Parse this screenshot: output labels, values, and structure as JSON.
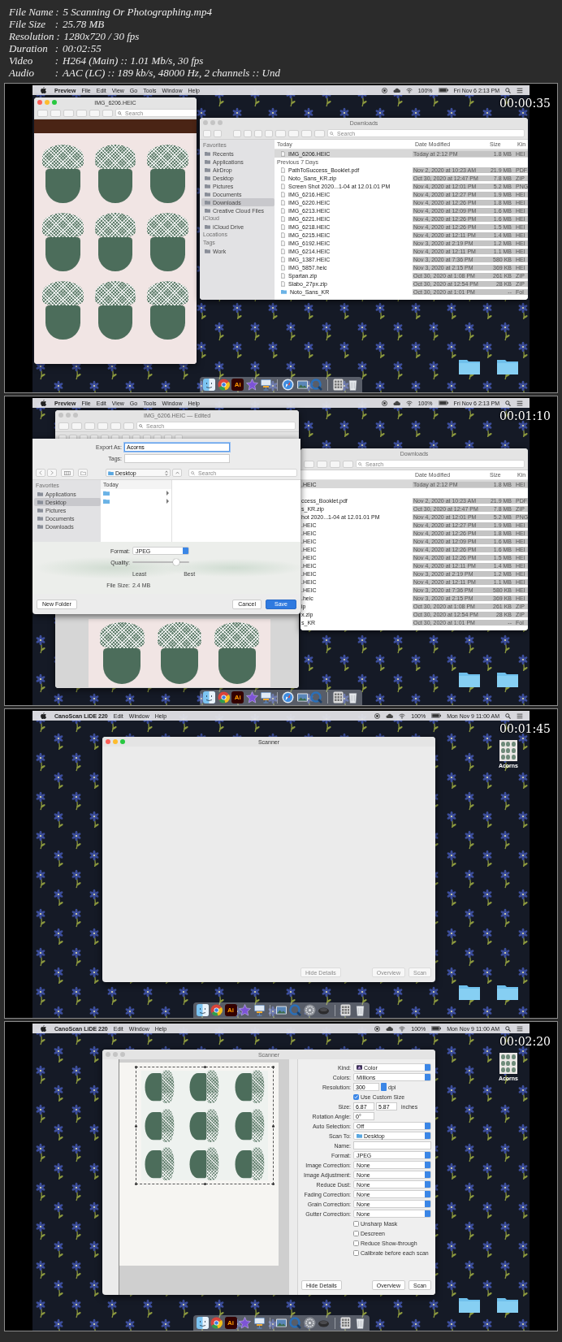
{
  "header": [
    {
      "label": "File Name",
      "separator": ":",
      "value": "5 Scanning Or Photographing.mp4"
    },
    {
      "label": "File Size",
      "separator": ":",
      "value": "25.78 MB"
    },
    {
      "label": "Resolution",
      "separator": ":",
      "value": "1280x720 / 30 fps"
    },
    {
      "label": "Duration",
      "separator": ":",
      "value": "00:02:55"
    },
    {
      "label": "Video",
      "separator": ":",
      "value": "H264 (Main) :: 1.01 Mb/s, 30 fps"
    },
    {
      "label": "Audio",
      "separator": ":",
      "value": "AAC (LC) :: 189 kb/s, 48000 Hz, 2 channels :: Und"
    }
  ],
  "frames": [
    {
      "timestamp": "00:00:35",
      "menu_bar": {
        "app": "Preview",
        "items": [
          "File",
          "Edit",
          "View",
          "Go",
          "Tools",
          "Window",
          "Help"
        ],
        "battery": "100%",
        "clock": "Fri Nov 6  2:13 PM"
      },
      "windows": [
        {
          "kind": "preview",
          "active": true,
          "title": "IMG_6206.HEIC",
          "search_placeholder": "Search"
        },
        {
          "kind": "finder",
          "active": false,
          "title": "Downloads",
          "search_placeholder": "Search",
          "sidebar": [
            {
              "heading": "Favorites",
              "items": [
                {
                  "label": "Recents",
                  "selected": false
                },
                {
                  "label": "Applications",
                  "selected": false
                },
                {
                  "label": "AirDrop",
                  "selected": false
                },
                {
                  "label": "Desktop",
                  "selected": false
                },
                {
                  "label": "Pictures",
                  "selected": false
                },
                {
                  "label": "Documents",
                  "selected": false
                },
                {
                  "label": "Downloads",
                  "selected": true
                },
                {
                  "label": "Creative Cloud Files",
                  "selected": false
                }
              ]
            },
            {
              "heading": "iCloud",
              "items": [
                {
                  "label": "iCloud Drive",
                  "selected": false
                }
              ]
            },
            {
              "heading": "Locations"
            },
            {
              "heading": "Tags",
              "items": [
                {
                  "label": "Work",
                  "selected": false
                }
              ]
            }
          ],
          "columns": {
            "name": "Today",
            "date": "Date Modified",
            "size": "Size",
            "kind": "Kin"
          },
          "sections": [
            {
              "rows": [
                {
                  "kind": "file",
                  "name": "IMG_6206.HEIC",
                  "date": "Today at 2:12 PM",
                  "size": "1.8 MB",
                  "kind_label": "HEI",
                  "selected": true
                }
              ]
            },
            {
              "heading": "Previous 7 Days",
              "rows": [
                {
                  "kind": "file",
                  "name": "PathToSuccess_Booklet.pdf",
                  "date": "Nov 2, 2020 at 10:23 AM",
                  "size": "21.9 MB",
                  "kind_label": "PDF",
                  "selected": false
                },
                {
                  "kind": "file",
                  "name": "Noto_Sans_KR.zip",
                  "date": "Oct 30, 2020 at 12:47 PM",
                  "size": "7.8 MB",
                  "kind_label": "ZIP",
                  "selected": false
                },
                {
                  "kind": "file",
                  "name": "Screen Shot 2020...1-04 at 12.01.01 PM",
                  "date": "Nov 4, 2020 at 12:01 PM",
                  "size": "5.2 MB",
                  "kind_label": "PNG",
                  "selected": false
                },
                {
                  "kind": "file",
                  "name": "IMG_6216.HEIC",
                  "date": "Nov 4, 2020 at 12:27 PM",
                  "size": "1.9 MB",
                  "kind_label": "HEI",
                  "selected": false
                },
                {
                  "kind": "file",
                  "name": "IMG_6220.HEIC",
                  "date": "Nov 4, 2020 at 12:26 PM",
                  "size": "1.8 MB",
                  "kind_label": "HEI",
                  "selected": false
                },
                {
                  "kind": "file",
                  "name": "IMG_6213.HEIC",
                  "date": "Nov 4, 2020 at 12:09 PM",
                  "size": "1.6 MB",
                  "kind_label": "HEI",
                  "selected": false
                },
                {
                  "kind": "file",
                  "name": "IMG_6221.HEIC",
                  "date": "Nov 4, 2020 at 12:26 PM",
                  "size": "1.6 MB",
                  "kind_label": "HEI",
                  "selected": false
                },
                {
                  "kind": "file",
                  "name": "IMG_6218.HEIC",
                  "date": "Nov 4, 2020 at 12:26 PM",
                  "size": "1.5 MB",
                  "kind_label": "HEI",
                  "selected": false
                },
                {
                  "kind": "file",
                  "name": "IMG_6215.HEIC",
                  "date": "Nov 4, 2020 at 12:11 PM",
                  "size": "1.4 MB",
                  "kind_label": "HEI",
                  "selected": false
                },
                {
                  "kind": "file",
                  "name": "IMG_6192.HEIC",
                  "date": "Nov 3, 2020 at 2:19 PM",
                  "size": "1.2 MB",
                  "kind_label": "HEI",
                  "selected": false
                },
                {
                  "kind": "file",
                  "name": "IMG_6214.HEIC",
                  "date": "Nov 4, 2020 at 12:11 PM",
                  "size": "1.1 MB",
                  "kind_label": "HEI",
                  "selected": false
                },
                {
                  "kind": "file",
                  "name": "IMG_1387.HEIC",
                  "date": "Nov 3, 2020 at 7:36 PM",
                  "size": "580 KB",
                  "kind_label": "HEI",
                  "selected": false
                },
                {
                  "kind": "file",
                  "name": "IMG_5857.heic",
                  "date": "Nov 3, 2020 at 2:15 PM",
                  "size": "369 KB",
                  "kind_label": "HEI",
                  "selected": false
                },
                {
                  "kind": "file",
                  "name": "Spartan.zip",
                  "date": "Oct 30, 2020 at 1:08 PM",
                  "size": "261 KB",
                  "kind_label": "ZIP",
                  "selected": false
                },
                {
                  "kind": "file",
                  "name": "Slabo_27px.zip",
                  "date": "Oct 30, 2020 at 12:54 PM",
                  "size": "28 KB",
                  "kind_label": "ZIP",
                  "selected": false
                },
                {
                  "kind": "folder",
                  "name": "Noto_Sans_KR",
                  "date": "Oct 30, 2020 at 1:01 PM",
                  "size": "--",
                  "kind_label": "Fol",
                  "selected": false
                }
              ]
            }
          ]
        }
      ],
      "desktop_icons": [
        {
          "kind": "folder"
        },
        {
          "kind": "folder"
        }
      ],
      "dock": [
        {
          "kind": "finder"
        },
        {
          "kind": "chrome"
        },
        {
          "kind": "text",
          "text": "Ai"
        },
        {
          "kind": "star"
        },
        {
          "kind": "keynote"
        },
        {
          "kind": "separator"
        },
        {
          "kind": "safari"
        },
        {
          "kind": "photos"
        },
        {
          "kind": "quicktime"
        },
        {
          "kind": "separator"
        },
        {
          "kind": "calc"
        },
        {
          "kind": "trash"
        }
      ]
    },
    {
      "timestamp": "00:01:10",
      "menu_bar": {
        "app": "Preview",
        "items": [
          "File",
          "Edit",
          "View",
          "Go",
          "Tools",
          "Window",
          "Help"
        ],
        "battery": "100%",
        "clock": "Fri Nov 6  2:13 PM"
      },
      "windows": [
        {
          "kind": "preview",
          "active": false,
          "markup_toolbar": true,
          "title": "IMG_6206.HEIC — Edited",
          "search_placeholder": "Search"
        },
        {
          "kind": "finder",
          "title": "Downloads",
          "search_placeholder": "Search",
          "columns": {
            "date": "Date Modified",
            "size": "Size",
            "kind": "Kin"
          },
          "sections": [
            {
              "rows": [
                {
                  "name": ".HEIC",
                  "date": "Today at 2:12 PM",
                  "size": "1.8 MB",
                  "kind_label": "HEI",
                  "selected": true
                }
              ]
            },
            {
              "rows": [
                {
                  "name": "ccess_Booklet.pdf",
                  "date": "Nov 2, 2020 at 10:23 AM",
                  "size": "21.9 MB",
                  "kind_label": "PDF",
                  "selected": false
                },
                {
                  "name": "s_KR.zip",
                  "date": "Oct 30, 2020 at 12:47 PM",
                  "size": "7.8 MB",
                  "kind_label": "ZIP",
                  "selected": false
                },
                {
                  "name": "hot 2020...1-04 at 12.01.01 PM",
                  "date": "Nov 4, 2020 at 12:01 PM",
                  "size": "5.2 MB",
                  "kind_label": "PNG",
                  "selected": false
                },
                {
                  "name": ".HEIC",
                  "date": "Nov 4, 2020 at 12:27 PM",
                  "size": "1.9 MB",
                  "kind_label": "HEI",
                  "selected": false
                },
                {
                  "name": ".HEIC",
                  "date": "Nov 4, 2020 at 12:26 PM",
                  "size": "1.8 MB",
                  "kind_label": "HEI",
                  "selected": false
                },
                {
                  "name": ".HEIC",
                  "date": "Nov 4, 2020 at 12:09 PM",
                  "size": "1.6 MB",
                  "kind_label": "HEI",
                  "selected": false
                },
                {
                  "name": ".HEIC",
                  "date": "Nov 4, 2020 at 12:26 PM",
                  "size": "1.6 MB",
                  "kind_label": "HEI",
                  "selected": false
                },
                {
                  "name": ".HEIC",
                  "date": "Nov 4, 2020 at 12:26 PM",
                  "size": "1.5 MB",
                  "kind_label": "HEI",
                  "selected": false
                },
                {
                  "name": ".HEIC",
                  "date": "Nov 4, 2020 at 12:11 PM",
                  "size": "1.4 MB",
                  "kind_label": "HEI",
                  "selected": false
                },
                {
                  "name": ".HEIC",
                  "date": "Nov 3, 2020 at 2:19 PM",
                  "size": "1.2 MB",
                  "kind_label": "HEI",
                  "selected": false
                },
                {
                  "name": ".HEIC",
                  "date": "Nov 4, 2020 at 12:11 PM",
                  "size": "1.1 MB",
                  "kind_label": "HEI",
                  "selected": false
                },
                {
                  "name": ".HEIC",
                  "date": "Nov 3, 2020 at 7:36 PM",
                  "size": "580 KB",
                  "kind_label": "HEI",
                  "selected": false
                },
                {
                  "name": ".heic",
                  "date": "Nov 3, 2020 at 2:15 PM",
                  "size": "369 KB",
                  "kind_label": "HEI",
                  "selected": false
                },
                {
                  "name": "ip",
                  "date": "Oct 30, 2020 at 1:08 PM",
                  "size": "261 KB",
                  "kind_label": "ZIP",
                  "selected": false
                },
                {
                  "name": "x.zip",
                  "date": "Oct 30, 2020 at 12:54 PM",
                  "size": "28 KB",
                  "kind_label": "ZIP",
                  "selected": false
                },
                {
                  "name": "s_KR",
                  "date": "Oct 30, 2020 at 1:01 PM",
                  "size": "--",
                  "kind_label": "Fol",
                  "selected": false
                }
              ]
            }
          ]
        },
        {
          "kind": "export_dialog",
          "export_as_label": "Export As:",
          "export_as_value": "Acorns",
          "tags_label": "Tags:",
          "location": "Desktop",
          "search_placeholder": "Search",
          "sidebar": [
            {
              "heading": "Favorites",
              "items": [
                {
                  "label": "Applications",
                  "selected": false
                },
                {
                  "label": "Desktop",
                  "selected": true
                },
                {
                  "label": "Pictures",
                  "selected": false
                },
                {
                  "label": "Documents",
                  "selected": false
                },
                {
                  "label": "Downloads",
                  "selected": false
                }
              ]
            }
          ],
          "column_heading": "Today",
          "column_items": [
            {
              "kind": "folder"
            },
            {
              "kind": "folder"
            }
          ],
          "format_label": "Format:",
          "format": "JPEG",
          "quality_label": "Quality:",
          "quality": {
            "level": 0.77
          },
          "least": "Least",
          "best": "Best",
          "file_size_label": "File Size:",
          "file_size": "2.4 MB",
          "buttons": [
            {
              "label": "New Folder",
              "kind": "plain"
            },
            {
              "label": "Cancel",
              "kind": "plain"
            },
            {
              "label": "Save",
              "kind": "default"
            }
          ]
        }
      ],
      "desktop_icons": [
        {
          "kind": "folder"
        },
        {
          "kind": "folder"
        }
      ],
      "dock": [
        {
          "kind": "finder"
        },
        {
          "kind": "chrome"
        },
        {
          "kind": "text",
          "text": "Ai"
        },
        {
          "kind": "star"
        },
        {
          "kind": "keynote"
        },
        {
          "kind": "separator"
        },
        {
          "kind": "safari"
        },
        {
          "kind": "photos"
        },
        {
          "kind": "quicktime"
        },
        {
          "kind": "separator"
        },
        {
          "kind": "calc"
        },
        {
          "kind": "trash"
        }
      ]
    },
    {
      "timestamp": "00:01:45",
      "menu_bar": {
        "app": "CanoScan LiDE 220",
        "items": [
          "Edit",
          "Window",
          "Help"
        ],
        "battery": "100%",
        "clock": "Mon Nov 9  11:00 AM"
      },
      "windows": [
        {
          "kind": "scanner",
          "active": true,
          "title": "Scanner",
          "buttons": [
            {
              "label": "Hide Details",
              "disabled": true
            },
            {
              "label": "Overview",
              "disabled": true
            },
            {
              "label": "Scan",
              "disabled": true
            }
          ]
        }
      ],
      "desktop_icons": [
        {
          "kind": "image",
          "label": "Acorns"
        },
        {
          "kind": "folder"
        },
        {
          "kind": "folder"
        }
      ],
      "dock": [
        {
          "kind": "finder"
        },
        {
          "kind": "chrome"
        },
        {
          "kind": "text",
          "text": "Ai"
        },
        {
          "kind": "star"
        },
        {
          "kind": "keynote"
        },
        {
          "kind": "separator"
        },
        {
          "kind": "photos"
        },
        {
          "kind": "quicktime"
        },
        {
          "kind": "prefs"
        },
        {
          "kind": "mouse"
        },
        {
          "kind": "separator"
        },
        {
          "kind": "calc"
        },
        {
          "kind": "trash"
        }
      ]
    },
    {
      "timestamp": "00:02:20",
      "menu_bar": {
        "app": "CanoScan LiDE 220",
        "items": [
          "Edit",
          "Window",
          "Help"
        ],
        "battery": "100%",
        "clock": "Mon Nov 9  11:00 AM"
      },
      "windows": [
        {
          "kind": "scanner",
          "active": false,
          "title": "Scanner",
          "preview_shown": true,
          "details": [
            {
              "kind": "color_popup",
              "label": "Kind:",
              "value": "Color"
            },
            {
              "kind": "popup",
              "label": "Colors:",
              "value": "Millions"
            },
            {
              "kind": "combo",
              "label": "Resolution:",
              "value": "300",
              "unit": "dpi"
            },
            {
              "kind": "checkbox",
              "label": "Use Custom Size",
              "checked": true
            },
            {
              "kind": "size",
              "label": "Size:",
              "values": [
                "6.87",
                "5.87"
              ],
              "unit": "inches"
            },
            {
              "kind": "short_text",
              "label": "Rotation Angle:",
              "value": "0°"
            },
            {
              "kind": "popup",
              "label": "Auto Selection:",
              "value": "Off"
            },
            {
              "kind": "folder_popup",
              "label": "Scan To:",
              "value": "Desktop"
            },
            {
              "kind": "text",
              "label": "Name:"
            },
            {
              "kind": "popup",
              "label": "Format:",
              "value": "JPEG"
            },
            {
              "kind": "popup",
              "label": "Image Correction:",
              "value": "None"
            },
            {
              "kind": "popup",
              "label": "Image Adjustment:",
              "value": "None"
            },
            {
              "kind": "popup",
              "label": "Reduce Dust:",
              "value": "None"
            },
            {
              "kind": "popup",
              "label": "Fading Correction:",
              "value": "None"
            },
            {
              "kind": "popup",
              "label": "Grain Correction:",
              "value": "None"
            },
            {
              "kind": "popup",
              "label": "Gutter Correction:",
              "value": "None"
            },
            {
              "kind": "checkbox",
              "label": "Unsharp Mask",
              "checked": false
            },
            {
              "kind": "checkbox",
              "label": "Descreen",
              "checked": false
            },
            {
              "kind": "checkbox",
              "label": "Reduce Show-through",
              "checked": false
            },
            {
              "kind": "checkbox",
              "label": "Calibrate before each scan",
              "checked": false
            }
          ],
          "buttons": [
            {
              "label": "Hide Details",
              "disabled": false
            },
            {
              "label": "Overview",
              "disabled": false
            },
            {
              "label": "Scan",
              "disabled": false
            }
          ]
        }
      ],
      "desktop_icons": [
        {
          "kind": "image",
          "label": "Acorns"
        },
        {
          "kind": "folder"
        },
        {
          "kind": "folder"
        }
      ],
      "dock": [
        {
          "kind": "finder"
        },
        {
          "kind": "chrome"
        },
        {
          "kind": "text",
          "text": "Ai"
        },
        {
          "kind": "star"
        },
        {
          "kind": "keynote"
        },
        {
          "kind": "separator"
        },
        {
          "kind": "photos"
        },
        {
          "kind": "quicktime"
        },
        {
          "kind": "prefs"
        },
        {
          "kind": "mouse"
        },
        {
          "kind": "separator"
        },
        {
          "kind": "calc"
        },
        {
          "kind": "trash"
        }
      ]
    }
  ]
}
